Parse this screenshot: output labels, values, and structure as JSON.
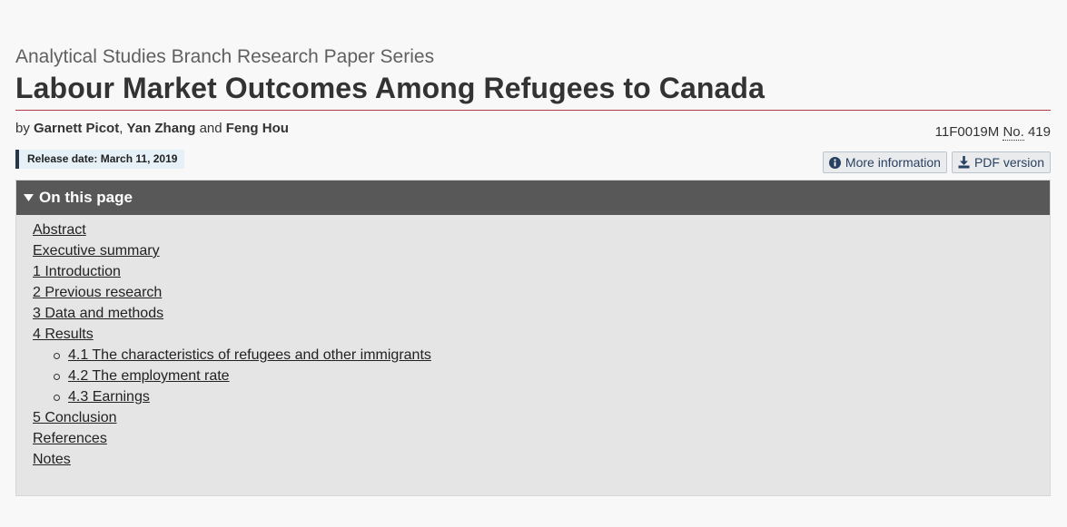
{
  "header": {
    "series": "Analytical Studies Branch Research Paper Series",
    "title": "Labour Market Outcomes Among Refugees to Canada"
  },
  "byline": {
    "prefix": "by",
    "authors": [
      "Garnett Picot",
      "Yan Zhang",
      "Feng Hou"
    ],
    "sep1": ",",
    "sep2": "and"
  },
  "catalogue": {
    "code": "11F0019M",
    "no_label": "No.",
    "number": "419"
  },
  "release": {
    "label": "Release date: March 11, 2019"
  },
  "buttons": {
    "more_info": "More information",
    "pdf": "PDF version"
  },
  "on_this_page": {
    "heading": "On this page",
    "items": [
      {
        "label": "Abstract"
      },
      {
        "label": "Executive summary"
      },
      {
        "label": "1 Introduction"
      },
      {
        "label": "2 Previous research"
      },
      {
        "label": "3 Data and methods"
      },
      {
        "label": "4 Results"
      },
      {
        "label": "5 Conclusion"
      },
      {
        "label": "References"
      },
      {
        "label": "Notes"
      }
    ],
    "subitems": [
      {
        "label": "4.1 The characteristics of refugees and other immigrants"
      },
      {
        "label": "4.2 The employment rate"
      },
      {
        "label": "4.3 Earnings"
      }
    ]
  },
  "colors": {
    "title_rule": "#af3c43",
    "header_bar": "#585858",
    "panel_bg": "#e5e5e5",
    "release_border": "#26374a",
    "button_text": "#284162"
  },
  "icons": {
    "more_info": "info-circle-icon",
    "pdf": "download-icon",
    "toggle": "triangle-down-icon"
  }
}
